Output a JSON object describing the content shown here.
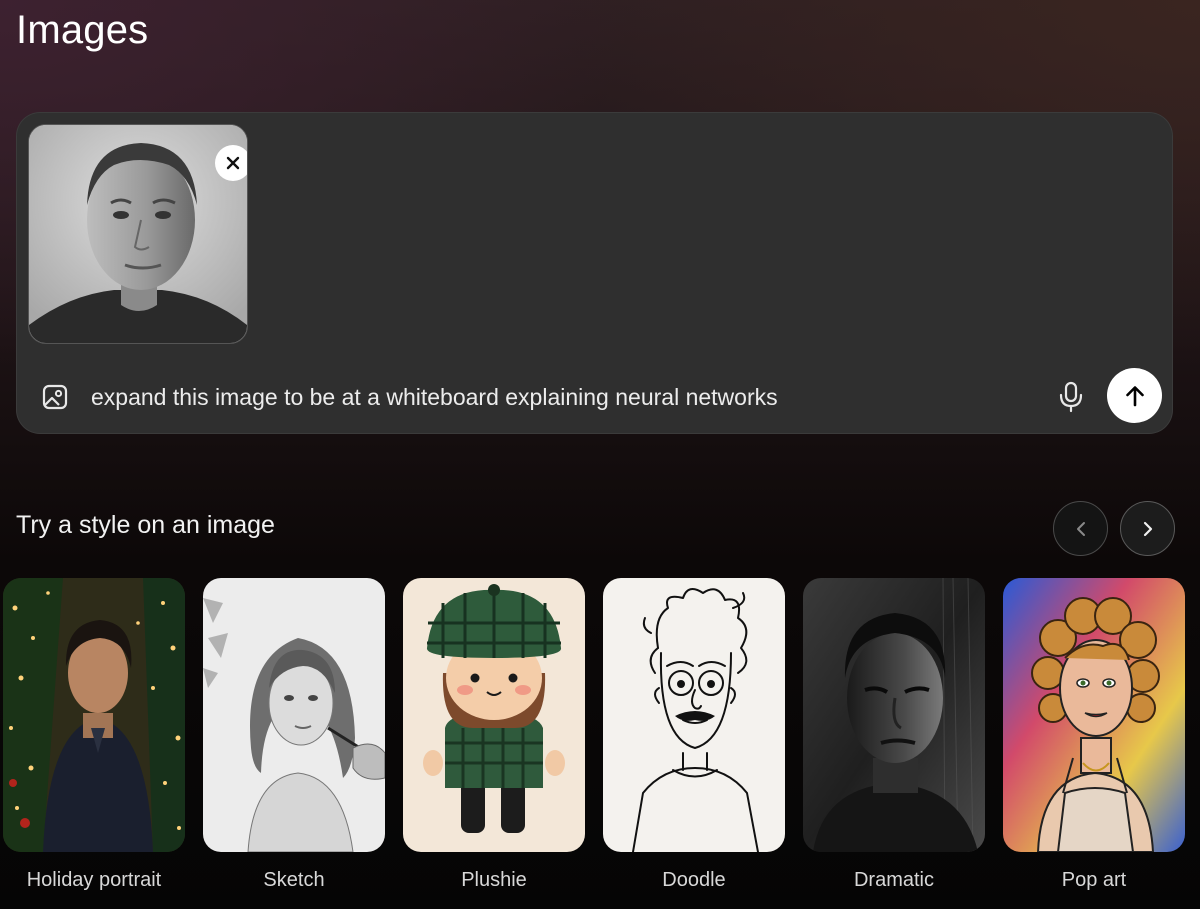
{
  "page": {
    "title": "Images"
  },
  "composer": {
    "attachment": {
      "alt": "attached portrait photo",
      "remove_icon": "close-icon"
    },
    "prompt_value": "expand this image to be at a whiteboard explaining neural networks",
    "icons": {
      "upload": "image-upload-icon",
      "mic": "microphone-icon",
      "send": "arrow-up-icon"
    }
  },
  "styles_section": {
    "title": "Try a style on an image",
    "nav": {
      "prev": "chevron-left-icon",
      "next": "chevron-right-icon"
    },
    "items": [
      {
        "label": "Holiday portrait"
      },
      {
        "label": "Sketch"
      },
      {
        "label": "Plushie"
      },
      {
        "label": "Doodle"
      },
      {
        "label": "Dramatic"
      },
      {
        "label": "Pop art"
      }
    ]
  },
  "colors": {
    "composer_bg": "#2f2f2f",
    "send_button": "#ffffff",
    "text": "#ececec"
  }
}
